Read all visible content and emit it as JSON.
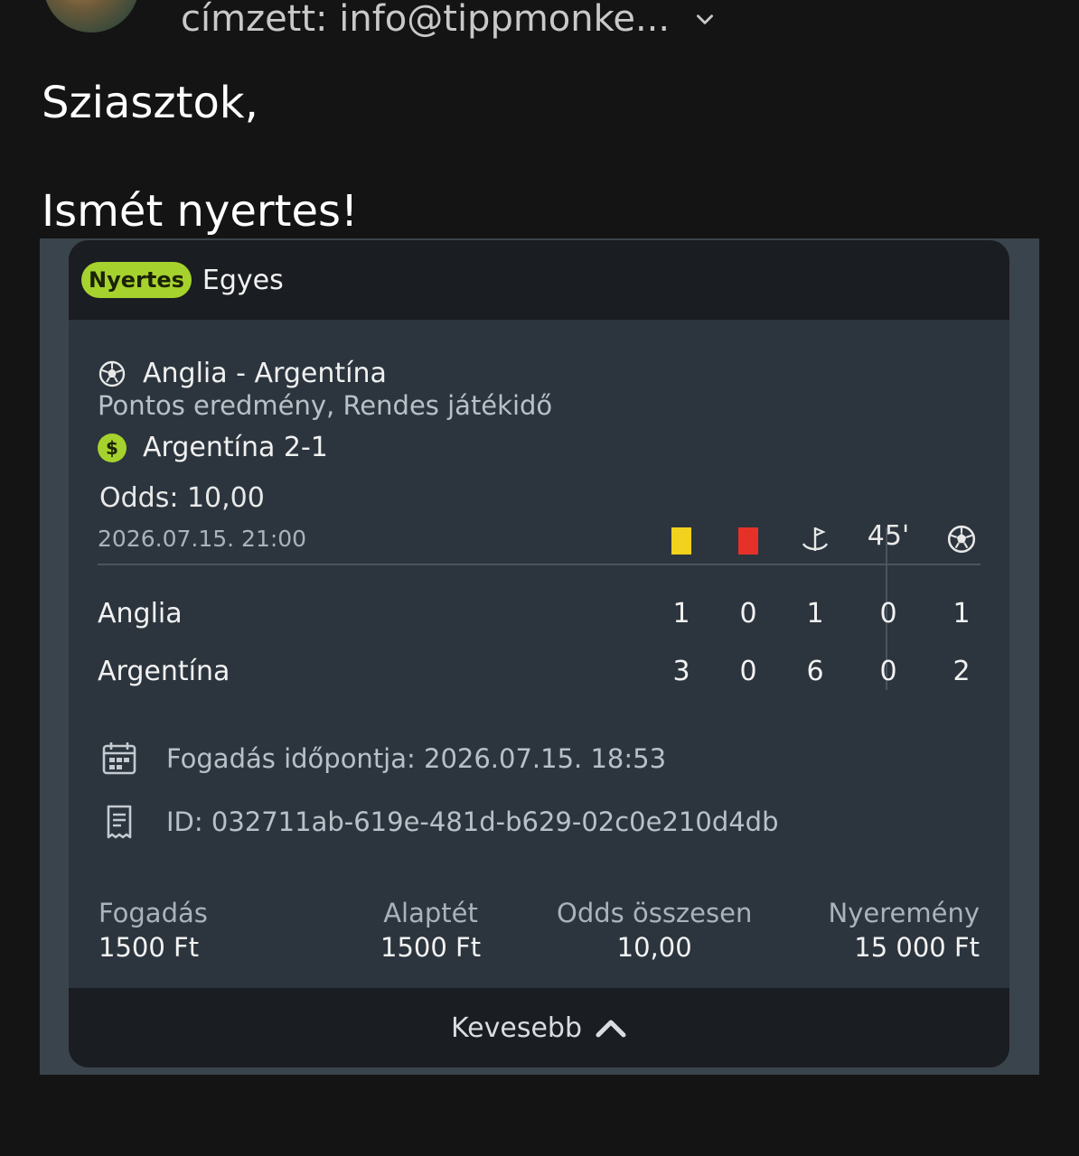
{
  "email": {
    "recipient_text": "címzett: info@tippmonke...",
    "greeting": "Sziasztok,",
    "message": "Ismét nyertes!"
  },
  "bet": {
    "status_badge": "Nyertes",
    "bet_type": "Egyes",
    "event_name": "Anglia - Argentína",
    "market": "Pontos eredmény, Rendes játékidő",
    "selection": "Argentína 2-1",
    "odds_text": "Odds: 10,00",
    "match_datetime": "2026.07.15. 21:00",
    "stat_header_time": "45'",
    "teams": [
      {
        "name": "Anglia",
        "stats": [
          "1",
          "0",
          "1",
          "0",
          "1"
        ]
      },
      {
        "name": "Argentína",
        "stats": [
          "3",
          "0",
          "6",
          "0",
          "2"
        ]
      }
    ],
    "bet_time": "Fogadás időpontja: 2026.07.15. 18:53",
    "bet_id": "ID: 032711ab-619e-481d-b629-02c0e210d4db",
    "summary": {
      "stake_label": "Fogadás",
      "stake_value": "1500 Ft",
      "base_label": "Alaptét",
      "base_value": "1500 Ft",
      "odds_label": "Odds összesen",
      "odds_value": "10,00",
      "win_label": "Nyeremény",
      "win_value": "15 000 Ft"
    },
    "collapse_label": "Kevesebb"
  },
  "colors": {
    "accent_green": "#a6d22e",
    "yellow_card": "#f2d21c",
    "red_card": "#e53128"
  },
  "icons": [
    "chevron-down-icon",
    "soccer-ball-icon",
    "dollar-icon",
    "yellow-card-icon",
    "red-card-icon",
    "corner-flag-icon",
    "calendar-icon",
    "receipt-icon",
    "chevron-up-icon"
  ]
}
